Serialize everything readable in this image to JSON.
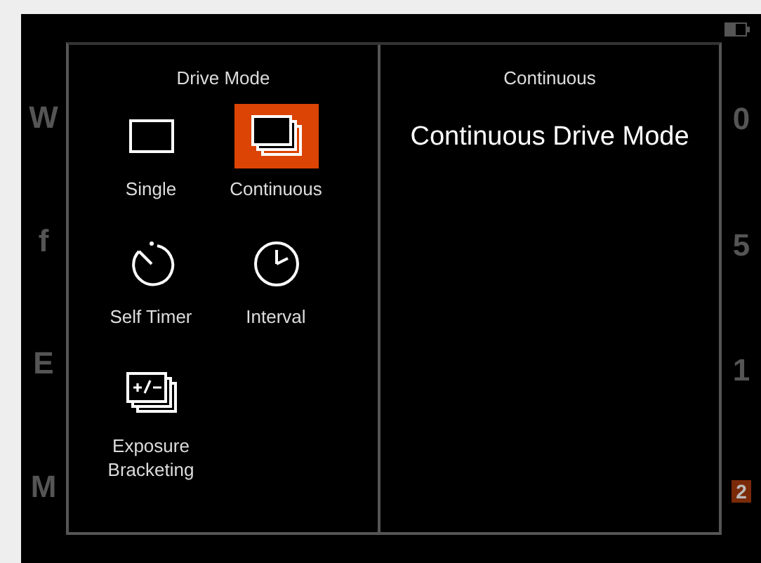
{
  "drive_mode": {
    "title": "Drive Mode",
    "modes": [
      {
        "kind": "single",
        "label": "Single",
        "selected": false
      },
      {
        "kind": "continuous",
        "label": "Continuous",
        "selected": true
      },
      {
        "kind": "self-timer",
        "label": "Self Timer",
        "selected": false
      },
      {
        "kind": "interval",
        "label": "Interval",
        "selected": false
      },
      {
        "kind": "bracketing",
        "label": "Exposure Bracketing",
        "selected": false
      }
    ]
  },
  "detail": {
    "title": "Continuous",
    "description": "Continuous Drive Mode"
  },
  "background": {
    "left_glyphs": [
      {
        "text": "W",
        "highlighted": false
      },
      {
        "text": "f",
        "highlighted": false
      },
      {
        "text": "E",
        "highlighted": false
      },
      {
        "text": "M",
        "highlighted": false
      }
    ],
    "right_glyphs": [
      {
        "text": "0",
        "highlighted": false
      },
      {
        "text": "5",
        "highlighted": false
      },
      {
        "text": "1",
        "highlighted": false
      },
      {
        "text": "2",
        "highlighted": true
      }
    ]
  }
}
